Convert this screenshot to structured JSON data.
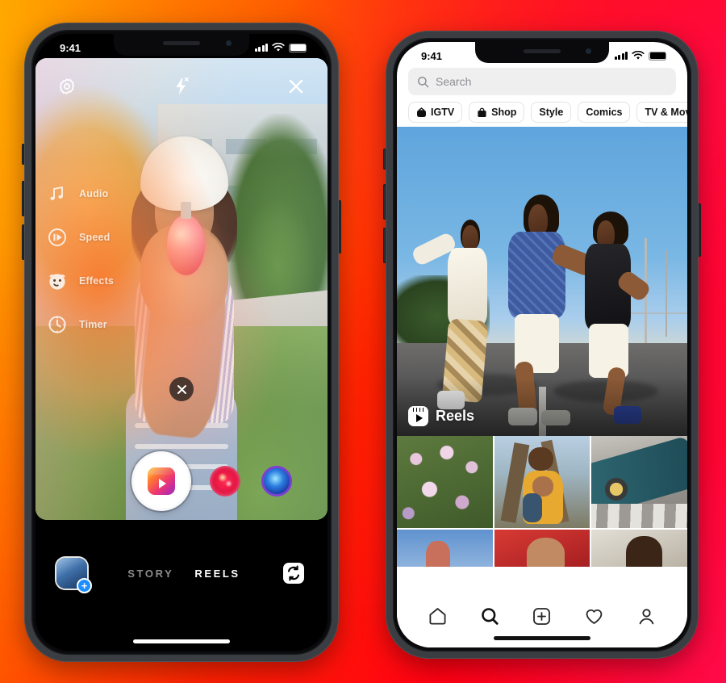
{
  "background": {
    "gradient_from": "#ffc400",
    "gradient_mid": "#ff2200",
    "gradient_to": "#ff0a52"
  },
  "left_phone": {
    "name": "instagram-reels-camera",
    "status_bar": {
      "time": "9:41",
      "signal_icon": "cellular-signal-icon",
      "wifi_icon": "wifi-icon",
      "battery_icon": "battery-icon"
    },
    "camera_top": {
      "settings_icon": "camera-settings-icon",
      "flash_icon": "flash-off-icon",
      "close_icon": "close-icon"
    },
    "sidebar": {
      "items": [
        {
          "label": "Audio",
          "icon": "music-note-icon"
        },
        {
          "label": "Speed",
          "icon": "speed-play-icon"
        },
        {
          "label": "Effects",
          "icon": "smiley-face-icon"
        },
        {
          "label": "Timer",
          "icon": "timer-icon"
        }
      ]
    },
    "clear_effect": {
      "icon": "close-icon"
    },
    "shutter": {
      "icon": "reels-gradient-icon"
    },
    "filters": [
      {
        "name": "sparkle-filter",
        "color": "#ff2d55"
      },
      {
        "name": "lens-filter",
        "color": "#2b7de0"
      }
    ],
    "bottom_bar": {
      "gallery_icon": "gallery-thumbnail-add-icon",
      "tabs": [
        {
          "label": "STORY",
          "active": false
        },
        {
          "label": "REELS",
          "active": true
        }
      ],
      "flip_camera_icon": "flip-camera-icon"
    }
  },
  "right_phone": {
    "name": "instagram-explore",
    "status_bar": {
      "time": "9:41",
      "signal_icon": "cellular-signal-icon",
      "wifi_icon": "wifi-icon",
      "battery_icon": "battery-icon"
    },
    "search": {
      "placeholder": "Search",
      "value": "",
      "icon": "search-icon"
    },
    "chips": [
      {
        "label": "IGTV",
        "icon": "igtv-icon"
      },
      {
        "label": "Shop",
        "icon": "shopping-bag-icon"
      },
      {
        "label": "Style",
        "icon": ""
      },
      {
        "label": "Comics",
        "icon": ""
      },
      {
        "label": "TV & Movies",
        "icon": ""
      }
    ],
    "hero": {
      "badge_label": "Reels",
      "badge_icon": "reels-clapperboard-icon"
    },
    "grid": [
      {
        "name": "grid-cell-flowers"
      },
      {
        "name": "grid-cell-kids"
      },
      {
        "name": "grid-cell-skateboard"
      },
      {
        "name": "grid-cell-sky-hand"
      },
      {
        "name": "grid-cell-red-hood"
      },
      {
        "name": "grid-cell-portrait"
      }
    ],
    "tabbar": [
      {
        "name": "home-icon",
        "active": false
      },
      {
        "name": "search-icon",
        "active": true
      },
      {
        "name": "add-post-icon",
        "active": false
      },
      {
        "name": "heart-icon",
        "active": false
      },
      {
        "name": "profile-icon",
        "active": false
      }
    ]
  }
}
